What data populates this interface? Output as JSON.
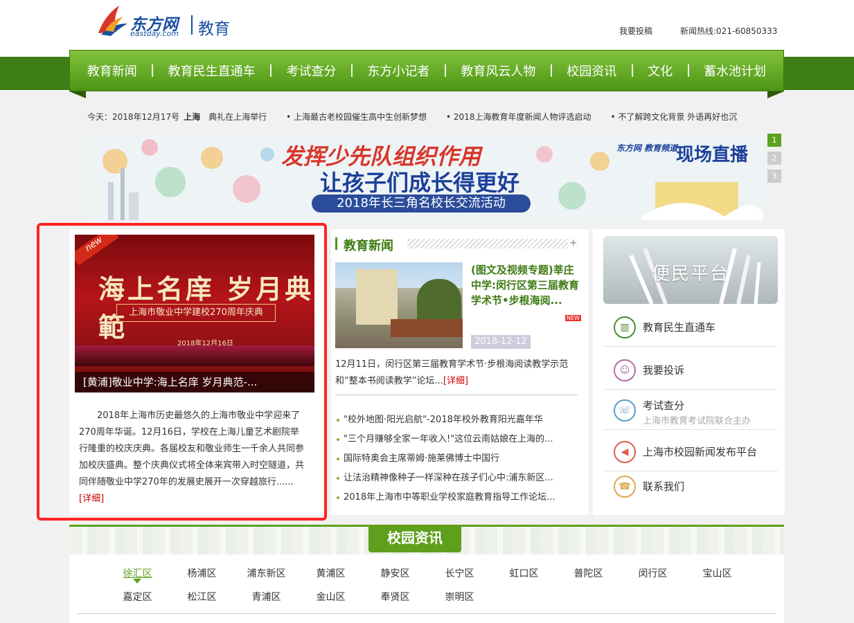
{
  "header": {
    "logo_cn": "东方网",
    "logo_en": "eastday.com",
    "logo_sub": "教育",
    "contribute": "我要投稿",
    "hotline": "新闻热线:021-60850333"
  },
  "nav": {
    "items": [
      "教育新闻",
      "教育民生直通车",
      "考试查分",
      "东方小记者",
      "教育风云人物",
      "校园资讯",
      "文化",
      "蓄水池计划"
    ]
  },
  "ticker": {
    "date": "今天：2018年12月17号",
    "city": "上海",
    "items": [
      "典礼在上海举行",
      "• 上海最古老校园催生高中生创新梦想",
      "• 2018上海教育年度新闻人物评选启动",
      "• 不了解跨文化背景 外语再好也沉"
    ]
  },
  "banner": {
    "line1": "发挥少先队组织作用",
    "line2": "让孩子们成长得更好",
    "line3": "2018年长三角名校长交流活动",
    "live_logo": "东方网 教育频道",
    "live": "现场直播",
    "pages": [
      "1",
      "2",
      "3"
    ]
  },
  "feature": {
    "badge": "new",
    "img_title": "海上名庠 岁月典範",
    "img_subtitle": "上海市敬业中学建校270周年庆典",
    "img_date": "2018年12月16日",
    "caption": "[黄浦]敬业中学:海上名庠 岁月典范-...",
    "text": "2018年上海市历史最悠久的上海市敬业中学迎来了270周年华诞。12月16日，学校在上海儿童艺术剧院举行隆重的校庆庆典。各届校友和敬业师生一千余人共同参加校庆盛典。整个庆典仪式将全体来宾带入时空隧道，共同伴随敬业中学270年的发展史展开一次穿越旅行......",
    "more": "[详细]"
  },
  "edu_news": {
    "title": "教育新闻",
    "plus": "+",
    "headline": "(图文及视频专题)莘庄中学:闵行区第三届教育学术节•步根海阅...",
    "new_tag": "NEW",
    "date": "2018-12-12",
    "summary": "12月11日，闵行区第三届教育学术节·步根海阅读教学示范和“整本书阅读教学”论坛...",
    "more": "[详细]",
    "list": [
      "\"校外地图·阳光启航\"-2018年校外教育阳光嘉年华",
      "\"三个月赚够全家一年收入!\"这位云南姑娘在上海的...",
      "国际特奥会主席蒂姆·施莱佛博士中国行",
      "让法治精神像种子一样深种在孩子们心中:浦东新区...",
      "2018年上海市中等职业学校家庭教育指导工作论坛..."
    ]
  },
  "services": {
    "title": "便民平台",
    "items": [
      {
        "label": "教育民生直通车",
        "sub": "",
        "color": "#4c8a2a",
        "icon": "building-icon"
      },
      {
        "label": "我要投诉",
        "sub": "",
        "color": "#b26aa8",
        "icon": "person-icon"
      },
      {
        "label": "考试查分",
        "sub": "上海市教育考试院联合主办",
        "color": "#5a9fc0",
        "icon": "phone-icon"
      },
      {
        "label": "上海市校园新闻发布平台",
        "sub": "",
        "color": "#e05a4e",
        "icon": "megaphone-icon"
      },
      {
        "label": "联系我们",
        "sub": "",
        "color": "#d9a94a",
        "icon": "telephone-icon"
      }
    ]
  },
  "campus": {
    "title": "校园资讯",
    "districts": [
      "徐汇区",
      "杨浦区",
      "浦东新区",
      "黄浦区",
      "静安区",
      "长宁区",
      "虹口区",
      "普陀区",
      "闵行区",
      "宝山区",
      "嘉定区",
      "松江区",
      "青浦区",
      "金山区",
      "奉贤区",
      "崇明区"
    ],
    "active": "徐汇区"
  }
}
